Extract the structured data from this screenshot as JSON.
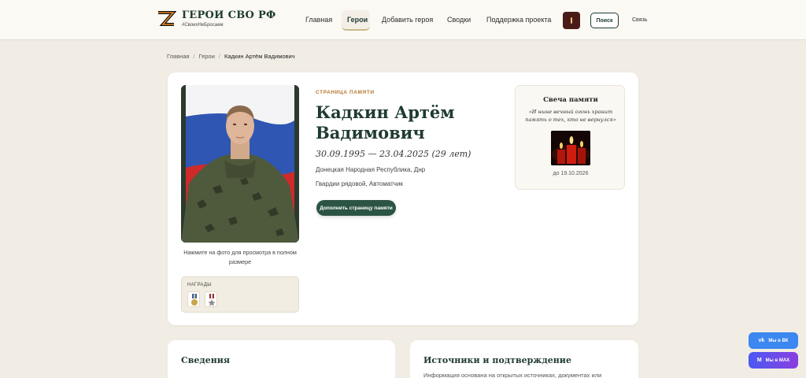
{
  "header": {
    "logo_title": "ГЕРОИ СВО РФ",
    "logo_tag": "#СвоихНеБросаем",
    "nav": [
      "Главная",
      "Герои",
      "Добавить героя",
      "Сводки",
      "Поддержка проекта"
    ],
    "active_nav": "Герои",
    "search_label": "Поиск",
    "contact_label": "Связь"
  },
  "breadcrumb": {
    "items": [
      "Главная",
      "Герои"
    ],
    "current": "Кадкин Артём Вадимович"
  },
  "hero": {
    "memory_label": "СТРАНИЦА ПАМЯТИ",
    "name": "Кадкин Артём Вадимович",
    "dates": "30.09.1995 — 23.04.2025 (29 лет)",
    "region": "Донецкая Народная Республика, Днр",
    "rank": "Гвардии рядовой, Автоматчик",
    "add_button": "Дополнить страницу памяти",
    "photo_caption": "Нажмите на фото для просмотра в полном размере",
    "awards_label": "НАГРАДЫ"
  },
  "candle": {
    "title": "Свеча памяти",
    "quote": "«И ныне вечный огонь хранит память о тех, кто не вернулся»",
    "until": "до 19.10.2026"
  },
  "sections": {
    "info_title": "Сведения",
    "sources_title": "Источники и подтверждение",
    "sources_text": "Информация основана на открытых источниках, документах или"
  },
  "floating": {
    "vk": "Мы в ВК",
    "max": "Мы в MAX"
  },
  "colors": {
    "accent": "#1f3b30",
    "button": "#2c5444",
    "background": "#f1ede4",
    "label": "#b7772d"
  }
}
